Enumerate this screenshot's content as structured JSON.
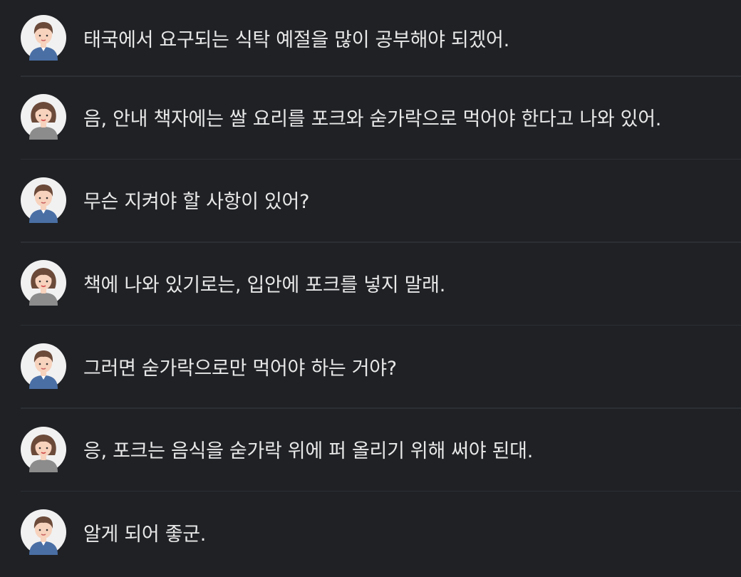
{
  "messages": [
    {
      "speaker": "male",
      "text": "태국에서 요구되는 식탁 예절을 많이 공부해야 되겠어."
    },
    {
      "speaker": "female",
      "text": "음, 안내 책자에는 쌀 요리를 포크와 숟가락으로 먹어야 한다고 나와 있어."
    },
    {
      "speaker": "male",
      "text": "무슨 지켜야 할 사항이 있어?"
    },
    {
      "speaker": "female",
      "text": "책에 나와 있기로는, 입안에 포크를 넣지 말래."
    },
    {
      "speaker": "male",
      "text": "그러면 숟가락으로만 먹어야 하는 거야?"
    },
    {
      "speaker": "female",
      "text": "응, 포크는 음식을 숟가락 위에 퍼 올리기 위해 써야 된대."
    },
    {
      "speaker": "male",
      "text": "알게 되어 좋군."
    }
  ],
  "colors": {
    "background": "#1f2125",
    "divider": "#2c2f34",
    "text": "#e8e8e8",
    "avatar_bg": "#f1f1f1",
    "hair": "#6b4a3a",
    "skin": "#f7d2bd",
    "male_shirt": "#4a6fa5",
    "female_shirt": "#8c8c8c"
  }
}
